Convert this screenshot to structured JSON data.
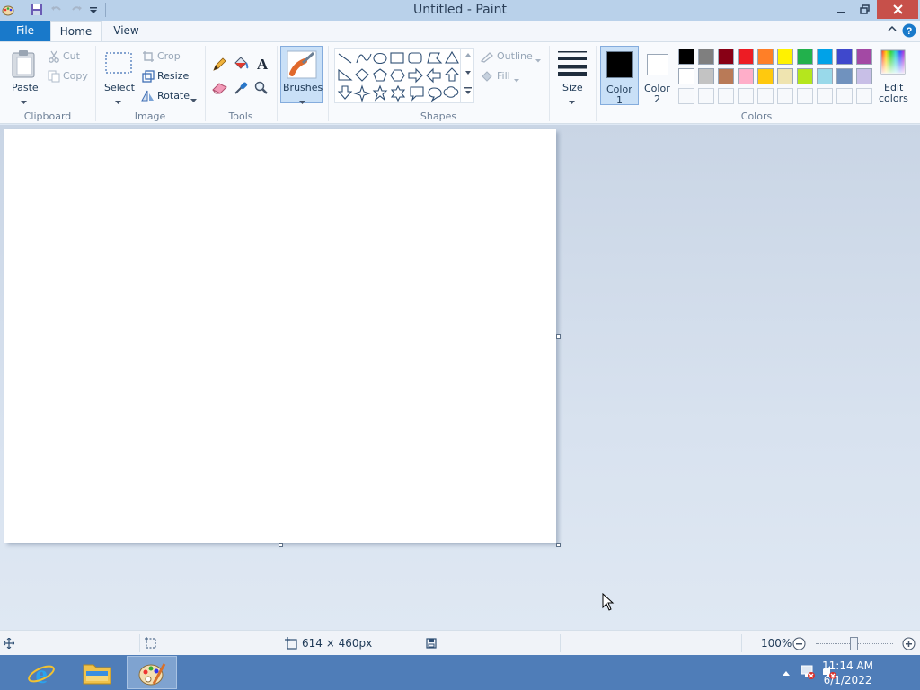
{
  "window": {
    "title": "Untitled - Paint"
  },
  "tabs": {
    "file": "File",
    "home": "Home",
    "view": "View"
  },
  "clipboard": {
    "paste": "Paste",
    "cut": "Cut",
    "copy": "Copy",
    "label": "Clipboard"
  },
  "image": {
    "select": "Select",
    "crop": "Crop",
    "resize": "Resize",
    "rotate": "Rotate",
    "label": "Image"
  },
  "tools": {
    "label": "Tools"
  },
  "brushes": {
    "label": "Brushes"
  },
  "shapes": {
    "outline": "Outline",
    "fill": "Fill",
    "label": "Shapes"
  },
  "size": {
    "label": "Size"
  },
  "colors": {
    "color1_line1": "Color",
    "color1_line2": "1",
    "color2_line1": "Color",
    "color2_line2": "2",
    "edit_line1": "Edit",
    "edit_line2": "colors",
    "label": "Colors",
    "color1_value": "#000000",
    "color2_value": "#ffffff",
    "palette_row1": [
      "#000000",
      "#7f7f7f",
      "#880015",
      "#ed1c24",
      "#ff7f27",
      "#fff200",
      "#22b14c",
      "#00a2e8",
      "#3f48cc",
      "#a349a4"
    ],
    "palette_row2": [
      "#ffffff",
      "#c3c3c3",
      "#b97a57",
      "#ffaec9",
      "#ffc90e",
      "#efe4b0",
      "#b5e61d",
      "#99d9ea",
      "#7092be",
      "#c8bfe7"
    ]
  },
  "status": {
    "dimensions": "614 × 460px",
    "zoom": "100%"
  },
  "taskbar": {
    "time": "11:14 AM",
    "date": "6/1/2022"
  }
}
